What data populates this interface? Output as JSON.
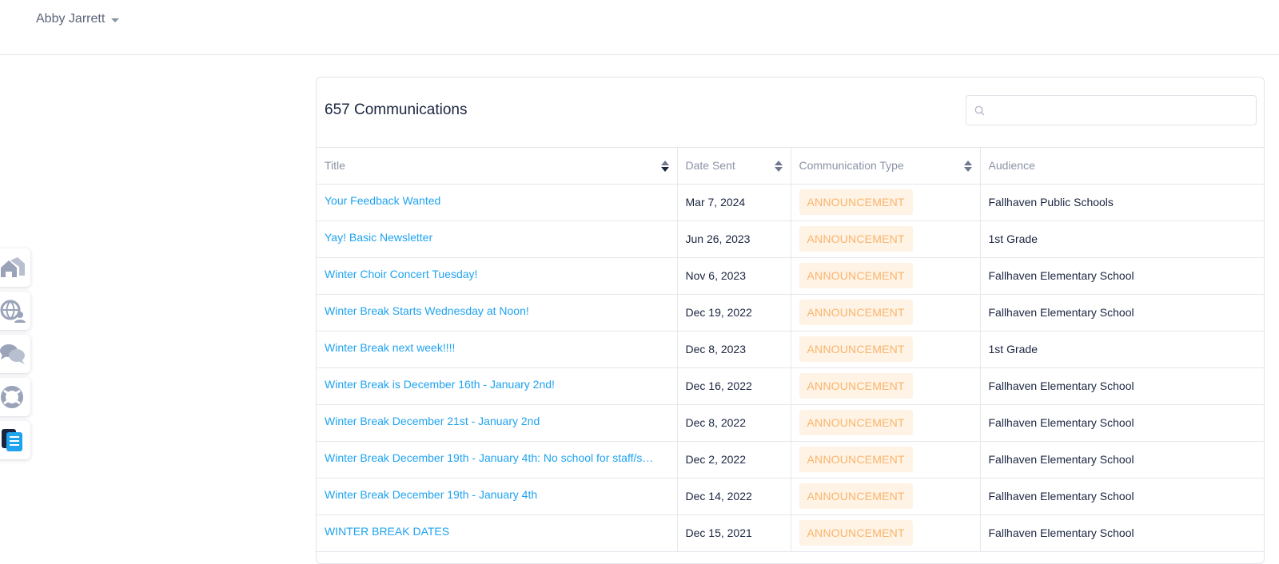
{
  "header": {
    "user_name": "Abby Jarrett"
  },
  "sidebar": {
    "items": [
      {
        "icon": "home-icon"
      },
      {
        "icon": "globe-people-icon"
      },
      {
        "icon": "chat-bubbles-icon"
      },
      {
        "icon": "life-ring-icon"
      },
      {
        "icon": "documents-icon",
        "active": true
      }
    ]
  },
  "card": {
    "title": "657 Communications",
    "search_placeholder": ""
  },
  "table": {
    "columns": [
      "Title",
      "Date Sent",
      "Communication Type",
      "Audience"
    ],
    "rows": [
      {
        "title": "Your Feedback Wanted",
        "date": "Mar 7, 2024",
        "type": "ANNOUNCEMENT",
        "audience": "Fallhaven Public Schools"
      },
      {
        "title": "Yay! Basic Newsletter",
        "date": "Jun 26, 2023",
        "type": "ANNOUNCEMENT",
        "audience": "1st Grade"
      },
      {
        "title": "Winter Choir Concert Tuesday!",
        "date": "Nov 6, 2023",
        "type": "ANNOUNCEMENT",
        "audience": "Fallhaven Elementary School"
      },
      {
        "title": "Winter Break Starts Wednesday at Noon!",
        "date": "Dec 19, 2022",
        "type": "ANNOUNCEMENT",
        "audience": "Fallhaven Elementary School"
      },
      {
        "title": "Winter Break next week!!!!",
        "date": "Dec 8, 2023",
        "type": "ANNOUNCEMENT",
        "audience": "1st Grade"
      },
      {
        "title": "Winter Break is December 16th - January 2nd!",
        "date": "Dec 16, 2022",
        "type": "ANNOUNCEMENT",
        "audience": "Fallhaven Elementary School"
      },
      {
        "title": "Winter Break December 21st - January 2nd",
        "date": "Dec 8, 2022",
        "type": "ANNOUNCEMENT",
        "audience": "Fallhaven Elementary School"
      },
      {
        "title": "Winter Break December 19th - January 4th: No school for staff/s…",
        "date": "Dec 2, 2022",
        "type": "ANNOUNCEMENT",
        "audience": "Fallhaven Elementary School"
      },
      {
        "title": "Winter Break December 19th - January 4th",
        "date": "Dec 14, 2022",
        "type": "ANNOUNCEMENT",
        "audience": "Fallhaven Elementary School"
      },
      {
        "title": "WINTER BREAK DATES",
        "date": "Dec 15, 2021",
        "type": "ANNOUNCEMENT",
        "audience": "Fallhaven Elementary School"
      }
    ]
  },
  "colors": {
    "link": "#1fa3ef",
    "badge_bg": "#fff3e6",
    "badge_text": "#f9b46a",
    "text": "#1b2540",
    "muted": "#8a93a6"
  }
}
